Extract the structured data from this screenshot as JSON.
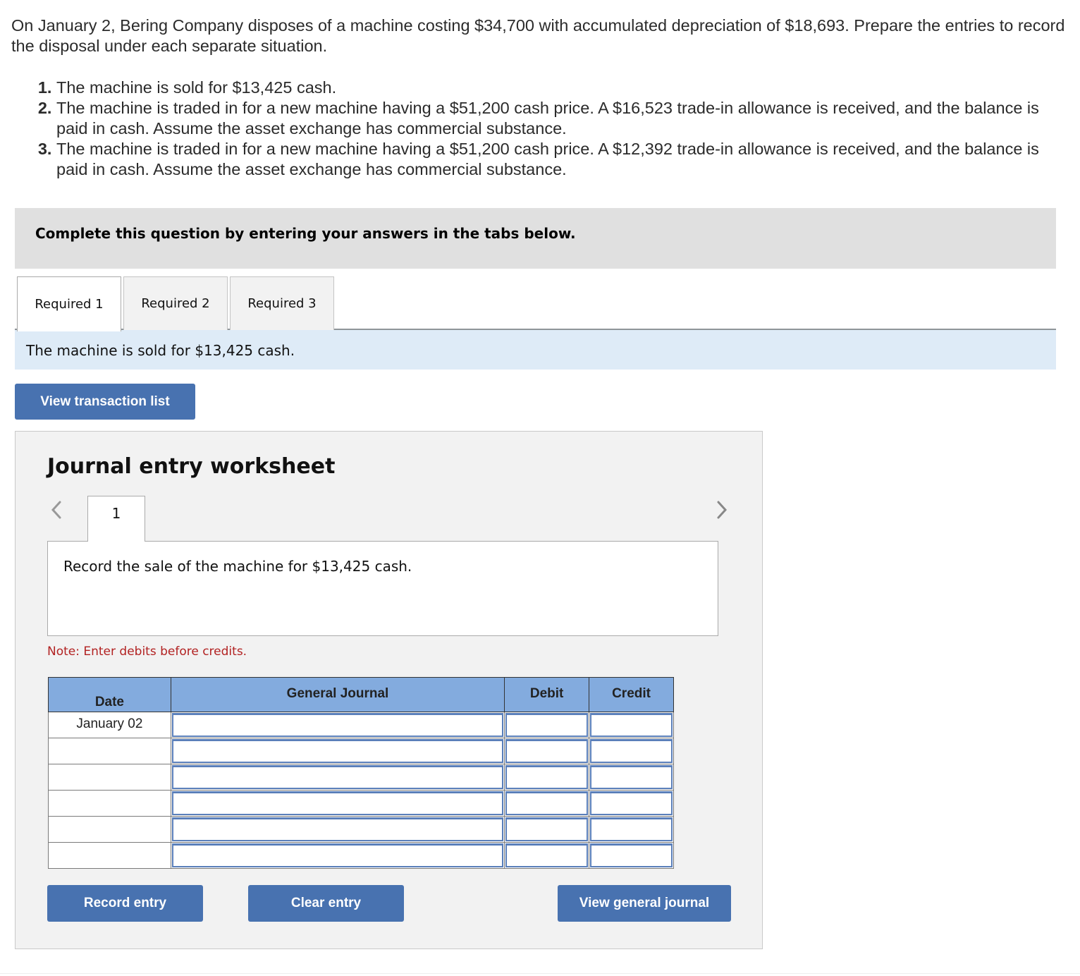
{
  "problem": {
    "intro": "On January 2, Bering Company disposes of a machine costing $34,700 with accumulated depreciation of $18,693. Prepare the entries to record the disposal under each separate situation.",
    "situations": [
      "The machine is sold for $13,425 cash.",
      "The machine is traded in for a new machine having a $51,200 cash price. A $16,523 trade-in allowance is received, and the balance is paid in cash. Assume the asset exchange has commercial substance.",
      "The machine is traded in for a new machine having a $51,200 cash price. A $12,392 trade-in allowance is received, and the balance is paid in cash. Assume the asset exchange has commercial substance."
    ]
  },
  "instruction": "Complete this question by entering your answers in the tabs below.",
  "tabs": [
    {
      "label": "Required 1",
      "active": true
    },
    {
      "label": "Required 2",
      "active": false
    },
    {
      "label": "Required 3",
      "active": false
    }
  ],
  "requirement_description": "The machine is sold for $13,425 cash.",
  "view_transaction_list_label": "View transaction list",
  "worksheet": {
    "title": "Journal entry worksheet",
    "prev_icon": "chevron-left-icon",
    "next_icon": "chevron-right-icon",
    "entry_tab_label": "1",
    "entry_description": "Record the sale of the machine for $13,425 cash.",
    "note": "Note: Enter debits before credits.",
    "table": {
      "headers": {
        "date": "Date",
        "general_journal": "General Journal",
        "debit": "Debit",
        "credit": "Credit"
      },
      "rows": [
        {
          "date": "January 02",
          "account": "",
          "debit": "",
          "credit": ""
        },
        {
          "date": "",
          "account": "",
          "debit": "",
          "credit": ""
        },
        {
          "date": "",
          "account": "",
          "debit": "",
          "credit": ""
        },
        {
          "date": "",
          "account": "",
          "debit": "",
          "credit": ""
        },
        {
          "date": "",
          "account": "",
          "debit": "",
          "credit": ""
        },
        {
          "date": "",
          "account": "",
          "debit": "",
          "credit": ""
        }
      ]
    },
    "buttons": {
      "record": "Record entry",
      "clear": "Clear entry",
      "view_general_journal": "View general journal"
    }
  },
  "colors": {
    "button": "#4872b0",
    "table_header": "#83abde",
    "req_desc_bg": "#deebf7",
    "note": "#b22222"
  }
}
